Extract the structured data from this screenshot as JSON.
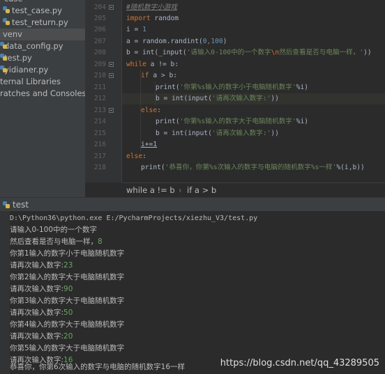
{
  "project_tree": {
    "items": [
      {
        "label": "case",
        "icon": "folder-icon"
      },
      {
        "label": "test_case.py",
        "icon": "python-file-icon"
      },
      {
        "label": "test_return.py",
        "icon": "python-file-icon"
      },
      {
        "label": "venv",
        "icon": "folder-icon"
      },
      {
        "label": "data_config.py",
        "icon": "python-file-icon"
      },
      {
        "label": "test.py",
        "icon": "python-file-icon"
      },
      {
        "label": "yidianer.py",
        "icon": "python-file-icon"
      },
      {
        "label": "ternal Libraries",
        "icon": "library-icon"
      },
      {
        "label": "ratches and Consoles",
        "icon": "scratch-icon"
      }
    ]
  },
  "editor": {
    "line_numbers": [
      "204",
      "205",
      "206",
      "207",
      "208",
      "209",
      "210",
      "211",
      "212",
      "213",
      "214",
      "215",
      "216",
      "217",
      "218"
    ],
    "code": {
      "l204_comment": "#随机数字小游戏",
      "l205_kw": "import",
      "l205_rest": " random",
      "l206_a": "i = ",
      "l206_num": "1",
      "l207_a": "a = random.randint(",
      "l207_n1": "0",
      "l207_sep": ",",
      "l207_n2": "100",
      "l207_end": ")",
      "l208_a": "b = int(_input(",
      "l208_s1": "'请输入0-100中的一个数字",
      "l208_esc": "\\n",
      "l208_s2": "然后查看是否与电脑一样，'",
      "l208_end": "))",
      "l209_kw": "while",
      "l209_rest": " a != b:",
      "l210_kw": "if",
      "l210_rest": " a > b:",
      "l211_a": "print(",
      "l211_s": "'你第%s输入的数字小于电脑随机数字'",
      "l211_b": "%i)",
      "l212_a": "b = int(input(",
      "l212_s": "'请再次输入数字:'",
      "l212_b": "))",
      "l213_kw": "else",
      "l213_rest": ":",
      "l214_a": "print(",
      "l214_s": "'你第%s输入的数字大于电脑随机数字'",
      "l214_b": "%i)",
      "l215_a": "b = int(input(",
      "l215_s": "'请再次输入数字:'",
      "l215_b": "))",
      "l216": "i+=1",
      "l217_kw": "else",
      "l217_rest": ":",
      "l218_a": "print(",
      "l218_s": "'恭喜你，你第%s次输入的数字与电脑的随机数字%s一样'",
      "l218_b": "%(i,b))"
    }
  },
  "breadcrumb": {
    "part1": "while a != b",
    "sep": "›",
    "part2": "if a > b"
  },
  "run_panel": {
    "tab_label": "test",
    "lines": [
      {
        "text": "D:\\Python36\\python.exe E:/PycharmProjects/xiezhu_V3/test.py",
        "input": ""
      },
      {
        "text": "请输入0-100中的一个数字",
        "input": ""
      },
      {
        "text": "然后查看是否与电脑一样，",
        "input": "8"
      },
      {
        "text": "你第1输入的数字小于电脑随机数字",
        "input": ""
      },
      {
        "text": "请再次输入数字:",
        "input": "23"
      },
      {
        "text": "你第2输入的数字大于电脑随机数字",
        "input": ""
      },
      {
        "text": "请再次输入数字:",
        "input": "90"
      },
      {
        "text": "你第3输入的数字大于电脑随机数字",
        "input": ""
      },
      {
        "text": "请再次输入数字:",
        "input": "50"
      },
      {
        "text": "你第4输入的数字大于电脑随机数字",
        "input": ""
      },
      {
        "text": "请再次输入数字:",
        "input": "20"
      },
      {
        "text": "你第5输入的数字大于电脑随机数字",
        "input": ""
      },
      {
        "text": "请再次输入数字:",
        "input": "16"
      },
      {
        "text": "恭喜你，你第6次输入的数字与电脑的随机数字16一样",
        "input": ""
      }
    ]
  },
  "watermark": "https://blog.csdn.net/qq_43289505",
  "colors": {
    "keyword": "#cc7832",
    "string": "#6a8759",
    "number": "#6897bb",
    "user_input": "#62a85c",
    "background": "#2b2b2b"
  }
}
